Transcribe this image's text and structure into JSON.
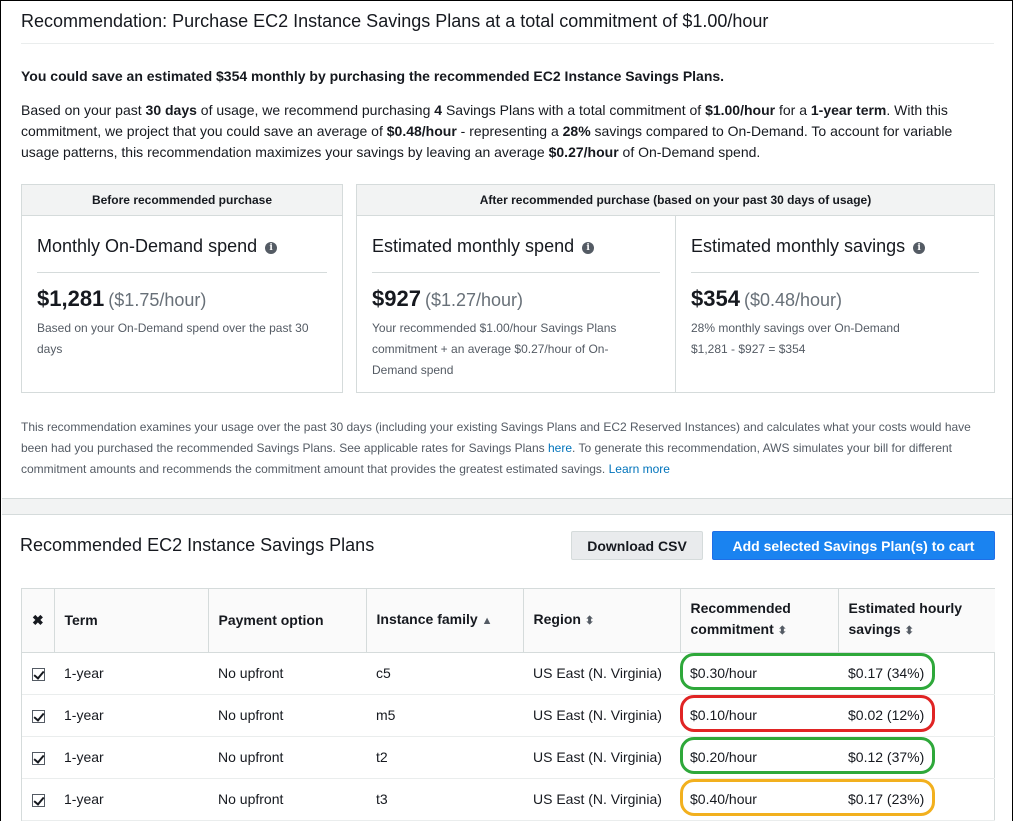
{
  "recommendation": {
    "title": "Recommendation: Purchase EC2 Instance Savings Plans at a total commitment of $1.00/hour",
    "headline": "You could save an estimated $354 monthly by purchasing the recommended EC2 Instance Savings Plans.",
    "para": {
      "t1": "Based on your past ",
      "days": "30 days",
      "t2": " of usage, we recommend purchasing ",
      "count": "4",
      "t3": " Savings Plans with a total commitment of ",
      "commit": "$1.00/hour",
      "t4": " for a ",
      "term": "1-year term",
      "t5": ". With this commitment, we project that you could save an average of ",
      "save": "$0.48/hour",
      "t6": " - representing a ",
      "pct": "28%",
      "t7": " savings compared to On-Demand. To account for variable usage patterns, this recommendation maximizes your savings by leaving an average ",
      "leave": "$0.27/hour",
      "t8": " of On-Demand spend."
    },
    "before_header": "Before recommended purchase",
    "after_header": "After recommended purchase (based on your past 30 days of usage)",
    "metrics": [
      {
        "title": "Monthly On-Demand spend",
        "value": "$1,281",
        "sub": "($1.75/hour)",
        "note": "Based on your On-Demand spend over the past 30 days"
      },
      {
        "title": "Estimated monthly spend",
        "value": "$927",
        "sub": "($1.27/hour)",
        "note": "Your recommended $1.00/hour Savings Plans commitment + an average $0.27/hour of On-Demand spend"
      },
      {
        "title": "Estimated monthly savings",
        "value": "$354",
        "sub": "($0.48/hour)",
        "note": "28% monthly savings over On-Demand",
        "note2": "$1,281 - $927 = $354"
      }
    ],
    "footnote": {
      "t1": "This recommendation examines your usage over the past 30 days (including your existing Savings Plans and EC2 Reserved Instances) and calculates what your costs would have been had you purchased the recommended Savings Plans. See applicable rates for Savings Plans ",
      "here": "here",
      "t2": ". To generate this recommendation, AWS simulates your bill for different commitment amounts and recommends the commitment amount that provides the greatest estimated savings. ",
      "learn": "Learn more"
    },
    "info_glyph": "i"
  },
  "plans": {
    "title": "Recommended EC2 Instance Savings Plans",
    "download_label": "Download CSV",
    "add_label": "Add selected Savings Plan(s) to cart",
    "columns": {
      "select": "✖",
      "term": "Term",
      "payment": "Payment option",
      "family": "Instance family",
      "region": "Region",
      "commitment": "Recommended commitment",
      "savings": "Estimated hourly savings"
    },
    "rows": [
      {
        "term": "1-year",
        "payment": "No upfront",
        "family": "c5",
        "region": "US East (N. Virginia)",
        "commitment": "$0.30/hour",
        "savings": "$0.17 (34%)",
        "highlight": "#2ea83a"
      },
      {
        "term": "1-year",
        "payment": "No upfront",
        "family": "m5",
        "region": "US East (N. Virginia)",
        "commitment": "$0.10/hour",
        "savings": "$0.02 (12%)",
        "highlight": "#e02424"
      },
      {
        "term": "1-year",
        "payment": "No upfront",
        "family": "t2",
        "region": "US East (N. Virginia)",
        "commitment": "$0.20/hour",
        "savings": "$0.12 (37%)",
        "highlight": "#2ea83a"
      },
      {
        "term": "1-year",
        "payment": "No upfront",
        "family": "t3",
        "region": "US East (N. Virginia)",
        "commitment": "$0.40/hour",
        "savings": "$0.17 (23%)",
        "highlight": "#f2b01e"
      }
    ]
  }
}
